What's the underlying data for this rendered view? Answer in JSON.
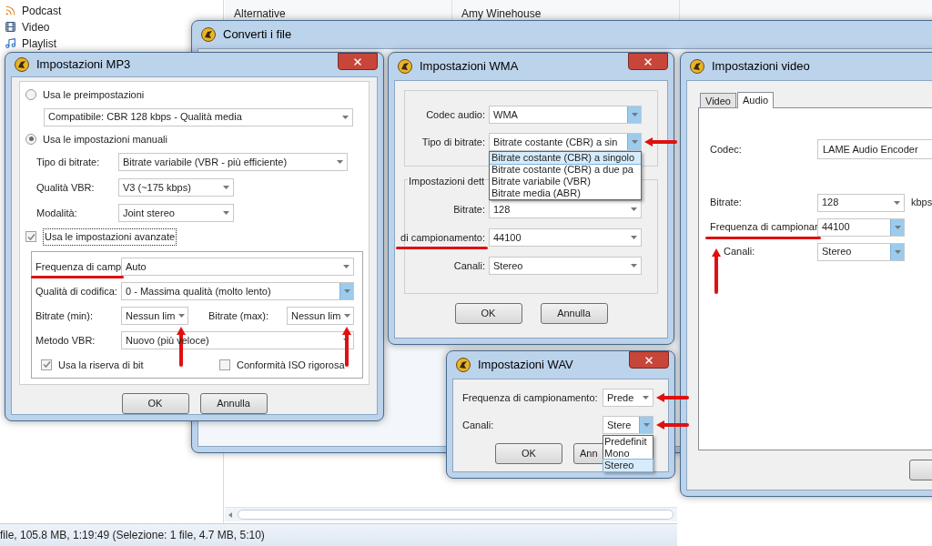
{
  "library": {
    "items": [
      {
        "kind": "podcast",
        "label": "Podcast"
      },
      {
        "kind": "video",
        "label": "Video"
      },
      {
        "kind": "playlist",
        "label": "Playlist"
      }
    ],
    "columns": [
      "Alternative",
      "Amy Winehouse"
    ],
    "status_bar": "file, 105.8 MB, 1:19:49 (Selezione: 1 file, 4.7 MB, 5:10)"
  },
  "convert_window": {
    "title": "Converti i file"
  },
  "mp3": {
    "title": "Impostazioni MP3",
    "preset": {
      "label": "Usa le preimpostazioni",
      "selected": false,
      "value": "Compatibile: CBR 128 kbps - Qualità media"
    },
    "manual": {
      "label": "Usa le impostazioni manuali",
      "selected": true
    },
    "manual_fields": [
      {
        "label": "Tipo di bitrate:",
        "value": "Bitrate variabile (VBR - più efficiente)",
        "highlighted": false
      },
      {
        "label": "Qualità VBR:",
        "value": "V3 (~175 kbps)",
        "highlighted": false
      },
      {
        "label": "Modalità:",
        "value": "Joint stereo",
        "highlighted": false
      }
    ],
    "advanced": {
      "label": "Usa le impostazioni avanzate",
      "checked": true
    },
    "advanced_rows": [
      {
        "fields": [
          {
            "label": "Frequenza di camp",
            "value": "Auto",
            "highlighted": false
          }
        ]
      },
      {
        "fields": [
          {
            "label": "Qualità di codifica:",
            "value": "0 - Massima qualità (molto lento)",
            "highlighted": true
          }
        ]
      },
      {
        "fields": [
          {
            "label": "Bitrate (min):",
            "value": "Nessun lim",
            "highlighted": false
          },
          {
            "label": "Bitrate (max):",
            "value": "Nessun lim",
            "highlighted": false
          }
        ]
      },
      {
        "fields": [
          {
            "label": "Metodo VBR:",
            "value": "Nuovo (più veloce)",
            "highlighted": false
          }
        ]
      }
    ],
    "checkboxes": [
      {
        "label": "Usa la riserva di bit",
        "checked": true
      },
      {
        "label": "Conformità ISO rigorosa",
        "checked": false
      }
    ],
    "buttons": [
      "OK",
      "Annulla"
    ]
  },
  "wma": {
    "title": "Impostazioni WMA",
    "fields": [
      {
        "label": "Codec audio:",
        "value": "WMA",
        "highlighted": true
      },
      {
        "label": "Tipo di bitrate:",
        "value": "Bitrate costante (CBR) a sin",
        "highlighted": true
      }
    ],
    "options": [
      {
        "label": "Bitrate costante (CBR) a singolo",
        "selected": true
      },
      {
        "label": "Bitrate costante (CBR) a due pa",
        "selected": false
      },
      {
        "label": "Bitrate variabile (VBR)",
        "selected": false
      },
      {
        "label": "Bitrate media (ABR)",
        "selected": false
      }
    ],
    "group": {
      "title": "Impostazioni dett",
      "fields": [
        {
          "label": "Bitrate:",
          "value": "128",
          "highlighted": false
        },
        {
          "label": "di campionamento:",
          "value": "44100",
          "highlighted": false
        },
        {
          "label": "Canali:",
          "value": "Stereo",
          "highlighted": false
        }
      ]
    },
    "buttons": [
      "OK",
      "Annulla"
    ]
  },
  "wav": {
    "title": "Impostazioni WAV",
    "fields": [
      {
        "label": "Frequenza di campionamento:",
        "value": "Prede",
        "highlighted": false
      },
      {
        "label": "Canali:",
        "value": "Stere",
        "highlighted": true
      }
    ],
    "options": [
      {
        "label": "Predefinit",
        "selected": false
      },
      {
        "label": "Mono",
        "selected": false
      },
      {
        "label": "Stereo",
        "selected": true
      }
    ],
    "buttons": [
      "OK",
      "Ann"
    ]
  },
  "video": {
    "title": "Impostazioni video",
    "tabs": [
      {
        "label": "Video",
        "selected": false
      },
      {
        "label": "Audio",
        "selected": true
      }
    ],
    "codec": {
      "label": "Codec:",
      "value": "LAME Audio Encoder"
    },
    "fields": [
      {
        "label": "Bitrate:",
        "value": "128",
        "unit": "kbps",
        "highlighted": false
      },
      {
        "label": "Frequenza di campionar",
        "value": "44100",
        "highlighted": true
      },
      {
        "label": "Canali:",
        "value": "Stereo",
        "highlighted": true
      }
    ]
  }
}
